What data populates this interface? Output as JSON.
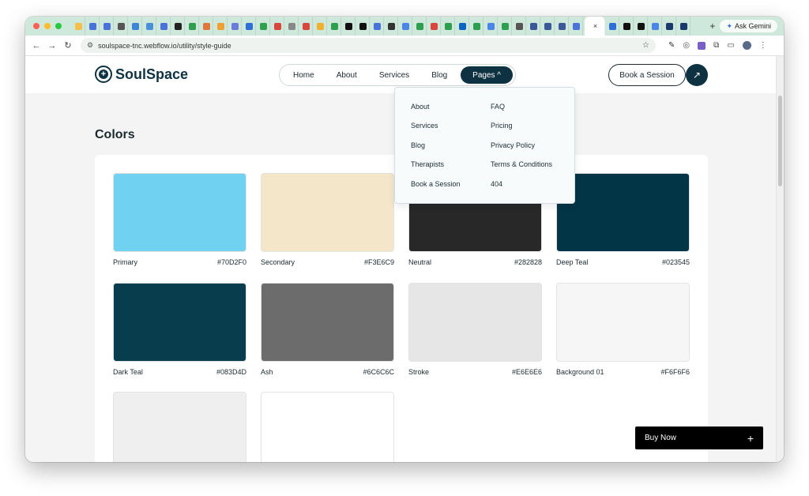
{
  "browser": {
    "gemini_label": "Ask Gemini",
    "url": "soulspace-tnc.webflow.io/utility/style-guide",
    "tab_close": "×",
    "new_tab": "+",
    "traffic": [
      "#ff5f57",
      "#febc2e",
      "#28c840"
    ],
    "favicons": [
      "#f5c04a",
      "#4a72d9",
      "#4a72d9",
      "#555555",
      "#3b86d9",
      "#4a90d9",
      "#4a72d9",
      "#222222",
      "#2e9e4f",
      "#e0763b",
      "#f0a030",
      "#6a7bd9",
      "#2d6fd6",
      "#2e9e4f",
      "#d9463b",
      "#888888",
      "#d9463b",
      "#f0b030",
      "#2e9e4f",
      "#111111",
      "#111111",
      "#4a72d9",
      "#333333",
      "#4a86e8",
      "#2e9e4f",
      "#d9463b",
      "#2e9e4f",
      "#0a66c2",
      "#2e9e4f",
      "#4a86e8",
      "#2e9e4f",
      "#555555",
      "#3b5998",
      "#3b5998",
      "#3b5998",
      "#4a72d9",
      "#2d6fd6",
      "#111111",
      "#111111",
      "#4a86e8",
      "#1a3a6b",
      "#1a3a6b"
    ]
  },
  "site": {
    "brand": "SoulSpace",
    "nav": [
      "Home",
      "About",
      "Services",
      "Blog"
    ],
    "nav_active": "Pages ^",
    "cta": "Book a Session",
    "arrow": "↗"
  },
  "dropdown": {
    "left": [
      "About",
      "Services",
      "Blog",
      "Therapists",
      "Book a Session"
    ],
    "right": [
      "FAQ",
      "Pricing",
      "Privacy Policy",
      "Terms & Conditions",
      "404"
    ]
  },
  "colors_section": {
    "title": "Colors",
    "swatches": [
      {
        "name": "Primary",
        "hex": "#70D2F0",
        "color": "#70D2F0"
      },
      {
        "name": "Secondary",
        "hex": "#F3E6C9",
        "color": "#F3E6C9"
      },
      {
        "name": "Neutral",
        "hex": "#282828",
        "color": "#282828"
      },
      {
        "name": "Deep Teal",
        "hex": "#023545",
        "color": "#023545"
      },
      {
        "name": "Dark Teal",
        "hex": "#083D4D",
        "color": "#083D4D"
      },
      {
        "name": "Ash",
        "hex": "#6C6C6C",
        "color": "#6C6C6C"
      },
      {
        "name": "Stroke",
        "hex": "#E6E6E6",
        "color": "#E6E6E6"
      },
      {
        "name": "Background 01",
        "hex": "#F6F6F6",
        "color": "#F6F6F6"
      },
      {
        "name": "",
        "hex": "",
        "color": "#EFEFEF"
      },
      {
        "name": "",
        "hex": "",
        "color": "#FFFFFF"
      }
    ]
  },
  "buy_now": {
    "label": "Buy Now",
    "icon": "+"
  }
}
